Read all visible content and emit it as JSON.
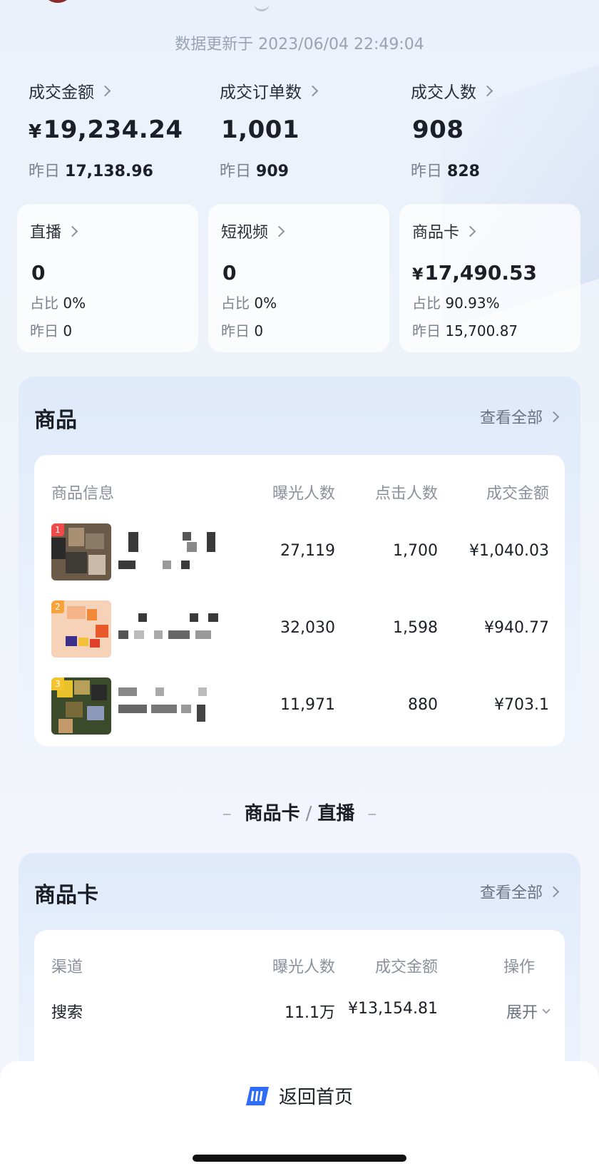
{
  "header": {
    "update_time": "数据更新于 2023/06/04 22:49:04"
  },
  "metrics": [
    {
      "label": "成交金额",
      "currency": "¥",
      "value": "19,234.24",
      "yesterday_label": "昨日",
      "yesterday": "17,138.96"
    },
    {
      "label": "成交订单数",
      "currency": "",
      "value": "1,001",
      "yesterday_label": "昨日",
      "yesterday": "909"
    },
    {
      "label": "成交人数",
      "currency": "",
      "value": "908",
      "yesterday_label": "昨日",
      "yesterday": "828"
    }
  ],
  "channels": [
    {
      "label": "直播",
      "currency": "",
      "value": "0",
      "share_label": "占比",
      "share": "0%",
      "yesterday_label": "昨日",
      "yesterday": "0"
    },
    {
      "label": "短视频",
      "currency": "",
      "value": "0",
      "share_label": "占比",
      "share": "0%",
      "yesterday_label": "昨日",
      "yesterday": "0"
    },
    {
      "label": "商品卡",
      "currency": "¥",
      "value": "17,490.53",
      "share_label": "占比",
      "share": "90.93%",
      "yesterday_label": "昨日",
      "yesterday": "15,700.87"
    }
  ],
  "products": {
    "title": "商品",
    "view_all": "查看全部",
    "headers": [
      "商品信息",
      "曝光人数",
      "点击人数",
      "成交金额"
    ],
    "rows": [
      {
        "rank": "1",
        "rank_color": "#f04a4a",
        "exposure": "27,119",
        "clicks": "1,700",
        "amount": "¥1,040.03"
      },
      {
        "rank": "2",
        "rank_color": "#f7a23a",
        "exposure": "32,030",
        "clicks": "1,598",
        "amount": "¥940.77"
      },
      {
        "rank": "3",
        "rank_color": "#f5c32c",
        "exposure": "11,971",
        "clicks": "880",
        "amount": "¥703.1"
      }
    ]
  },
  "switcher": {
    "left": "商品卡",
    "sep": "/",
    "right": "直播",
    "dash": "–"
  },
  "product_card": {
    "title": "商品卡",
    "view_all": "查看全部",
    "headers": [
      "渠道",
      "曝光人数",
      "成交金额",
      "操作"
    ],
    "rows": [
      {
        "channel": "搜索",
        "exposure": "11.1万",
        "amount": "¥13,154.81",
        "action": "展开"
      }
    ]
  },
  "footer": {
    "home_label": "返回首页",
    "brand_color": "#2e6cf6"
  }
}
